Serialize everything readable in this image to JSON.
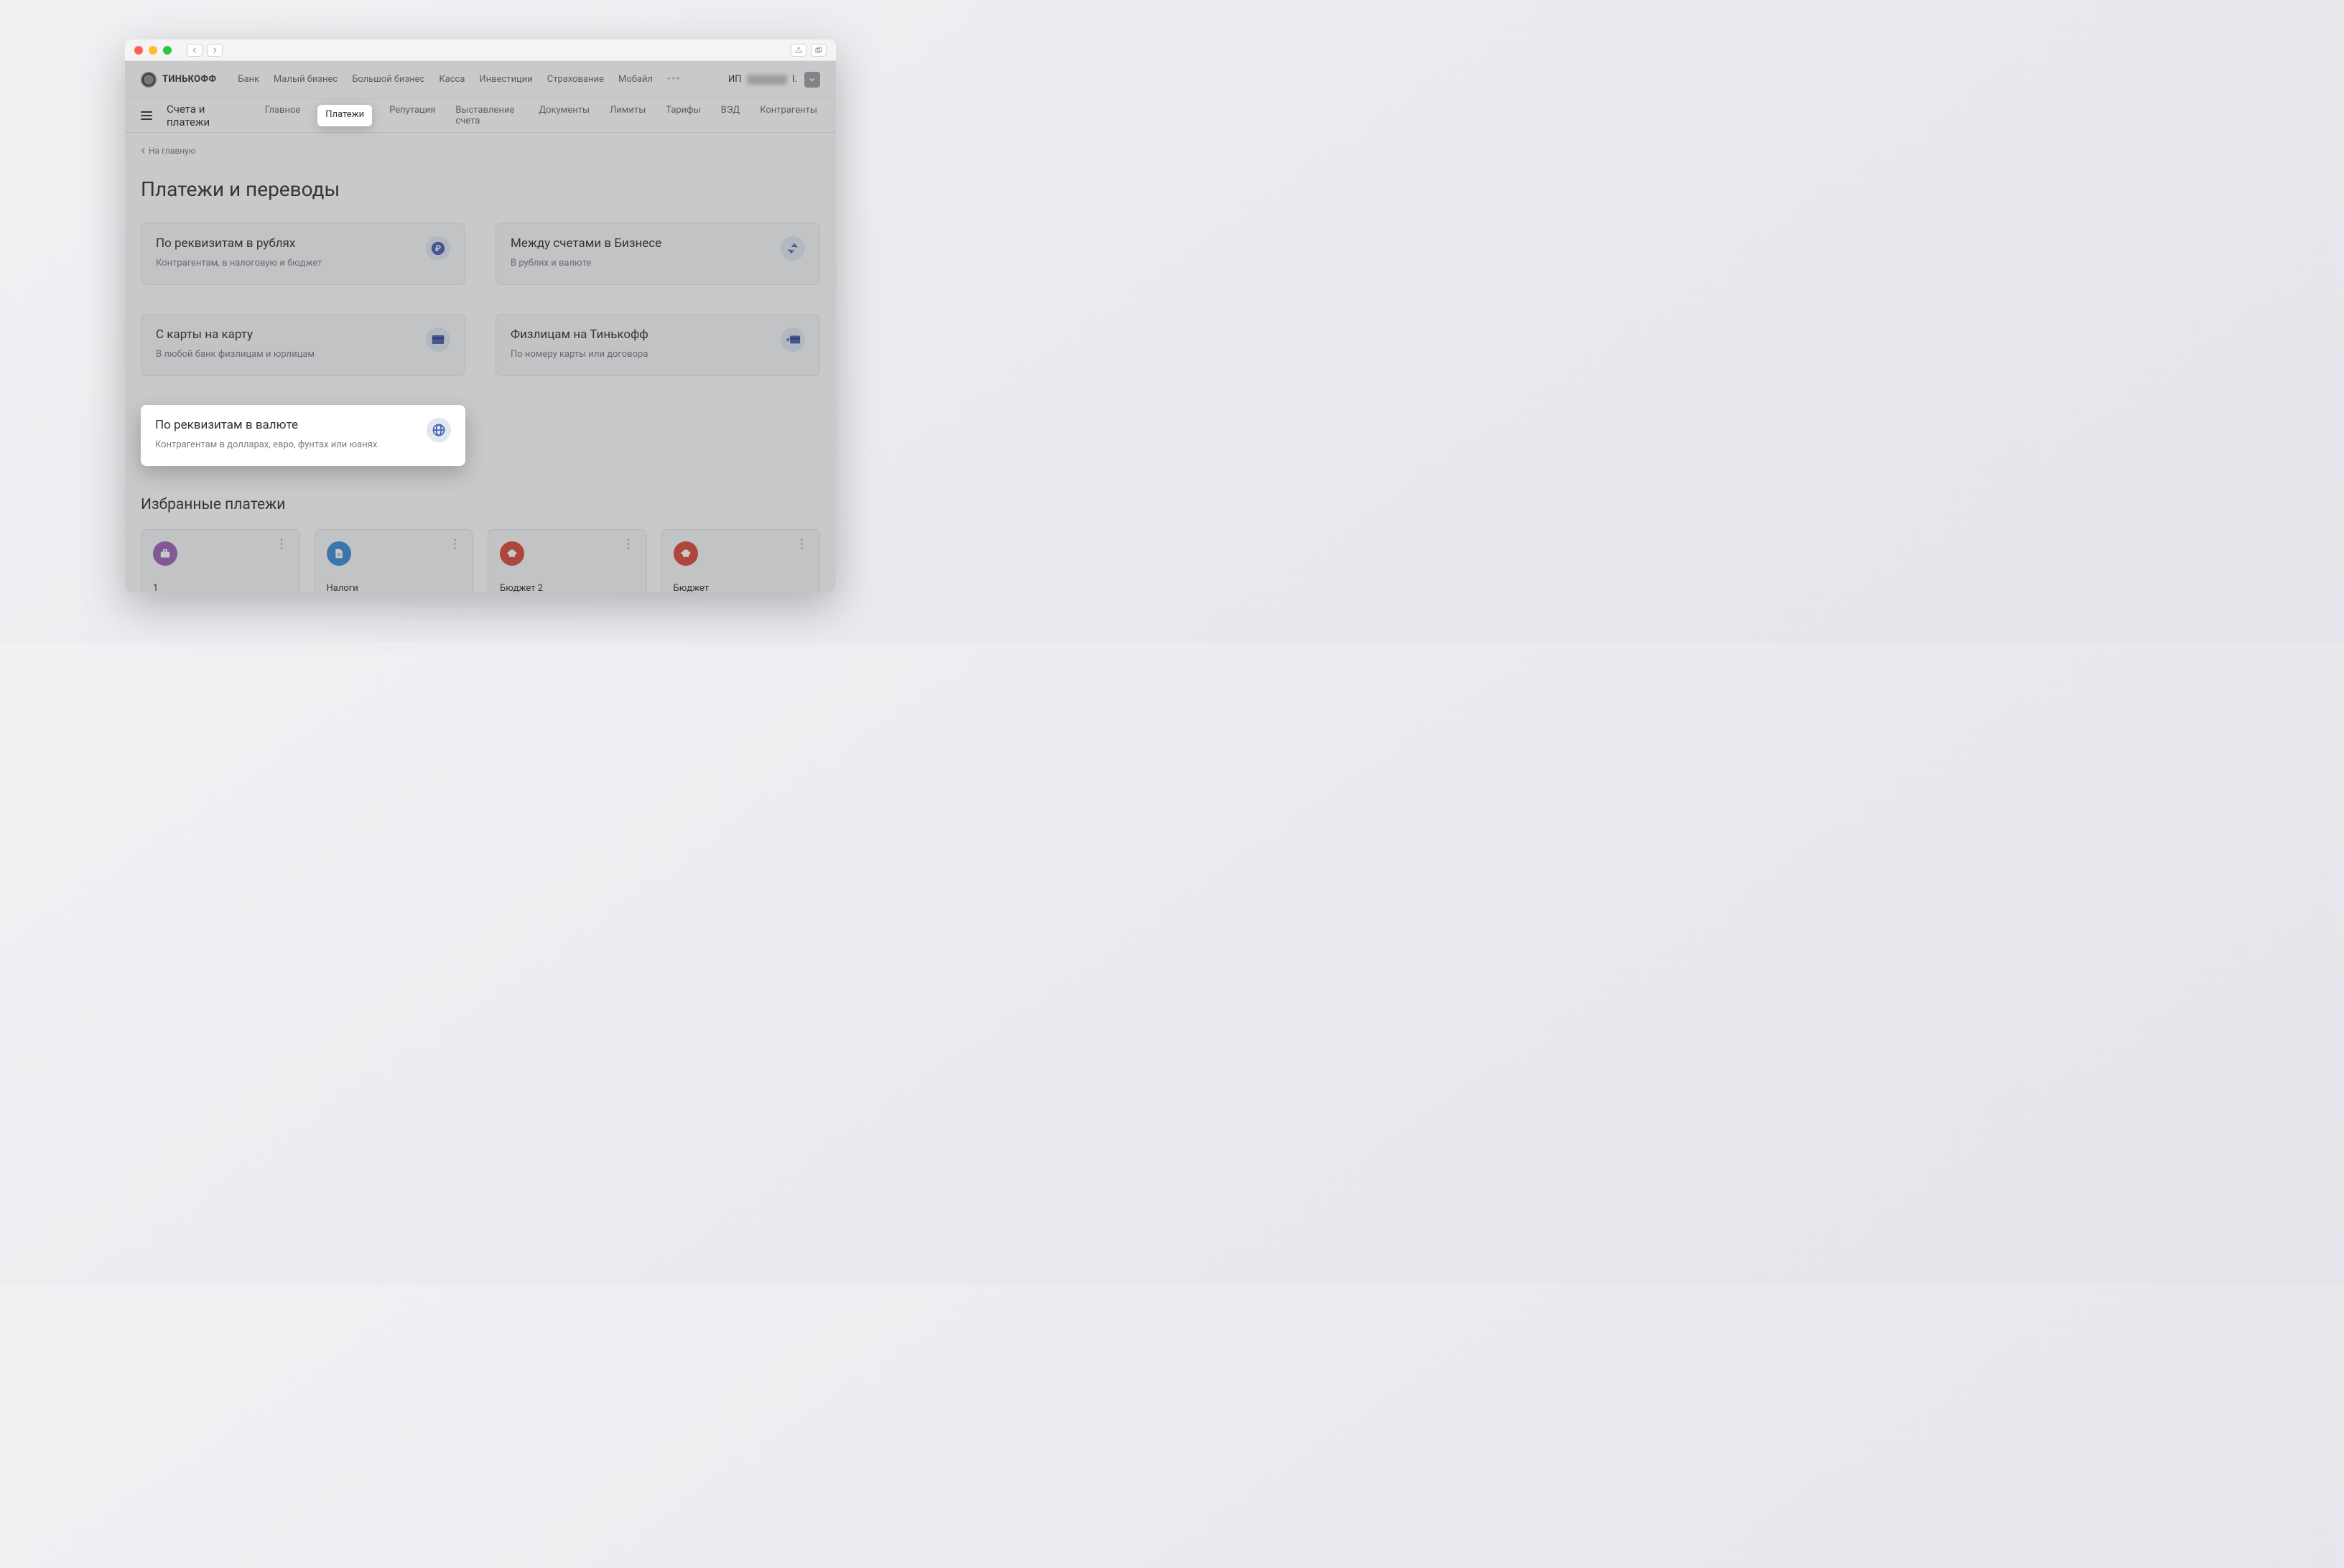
{
  "brand": {
    "name": "ТИНЬКОФФ"
  },
  "top_nav": [
    "Банк",
    "Малый бизнес",
    "Большой бизнес",
    "Касса",
    "Инвестиции",
    "Страхование",
    "Мобайл"
  ],
  "user": {
    "prefix": "ИП",
    "suffix": "I."
  },
  "sub_nav": {
    "title": "Счета и платежи",
    "items": [
      "Главное",
      "Платежи",
      "Репутация",
      "Выставление счета",
      "Документы",
      "Лимиты",
      "Тарифы",
      "ВЭД",
      "Контрагенты"
    ],
    "active_index": 1
  },
  "breadcrumb": "На главную",
  "page_heading": "Платежи и переводы",
  "tiles": [
    {
      "title": "По реквизитам в рублях",
      "sub": "Контрагентам, в налоговую и бюджет",
      "icon": "ruble"
    },
    {
      "title": "Между счетами в Бизнесе",
      "sub": "В рублях и валюте",
      "icon": "transfer"
    },
    {
      "title": "С карты на карту",
      "sub": "В любой банк физлицам и юрлицам",
      "icon": "card"
    },
    {
      "title": "Физлицам на Тинькофф",
      "sub": "По номеру карты или договора",
      "icon": "cardout"
    },
    {
      "title": "По реквизитам в валюте",
      "sub": "Контрагентам в долларах, евро, фунтах или юанях",
      "icon": "globe",
      "highlight": true
    }
  ],
  "favorites_heading": "Избранные платежи",
  "favorites": [
    {
      "label": "1",
      "icon": "briefcase",
      "color": "purple"
    },
    {
      "label": "Налоги",
      "icon": "doc",
      "color": "blue"
    },
    {
      "label": "Бюджет 2",
      "icon": "eagle",
      "color": "red"
    },
    {
      "label": "Бюджет",
      "icon": "eagle",
      "color": "red"
    }
  ],
  "colors": {
    "accent_blue": "#3b5ea8"
  }
}
